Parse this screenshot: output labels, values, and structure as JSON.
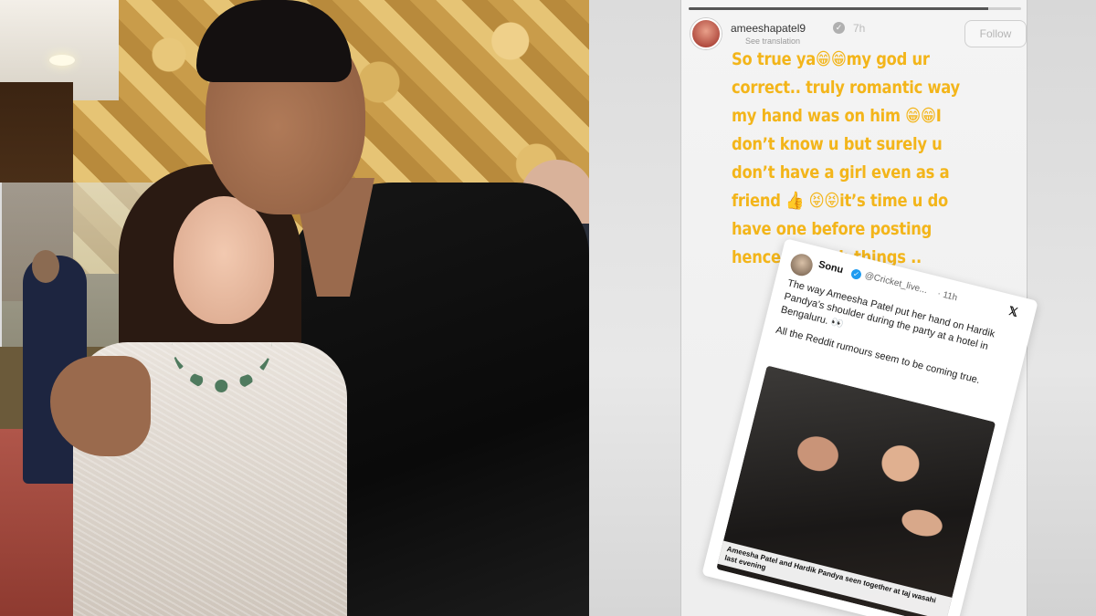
{
  "story": {
    "progress": 0.9,
    "username": "ameeshapatel9",
    "time": "7h",
    "see_translation": "See translation",
    "follow_label": "Follow",
    "text": "So true ya😁😁my god ur correct.. truly romantic way my hand was on him 😁😁I don’t know u but surely u don’t have a girl even as a friend 👍 😝😝it’s time u do have one before posting  hence on such things .."
  },
  "tweet": {
    "name": "Sonu",
    "handle": "@Cricket_live...",
    "time": "· 11h",
    "close_icon": "x-logo-icon",
    "body_1": "The way Ameesha Patel put her hand on Hardik Pandya’s shoulder during the party at a hotel in Bengaluru. 👀",
    "body_2": "All the Reddit rumours seem to be coming true.",
    "caption": "Ameesha Patel and Hardik Pandya seen together at taj wasahi last evening"
  },
  "colors": {
    "story_text": "#f3b51a",
    "verified_badge": "#1d9bf0"
  }
}
